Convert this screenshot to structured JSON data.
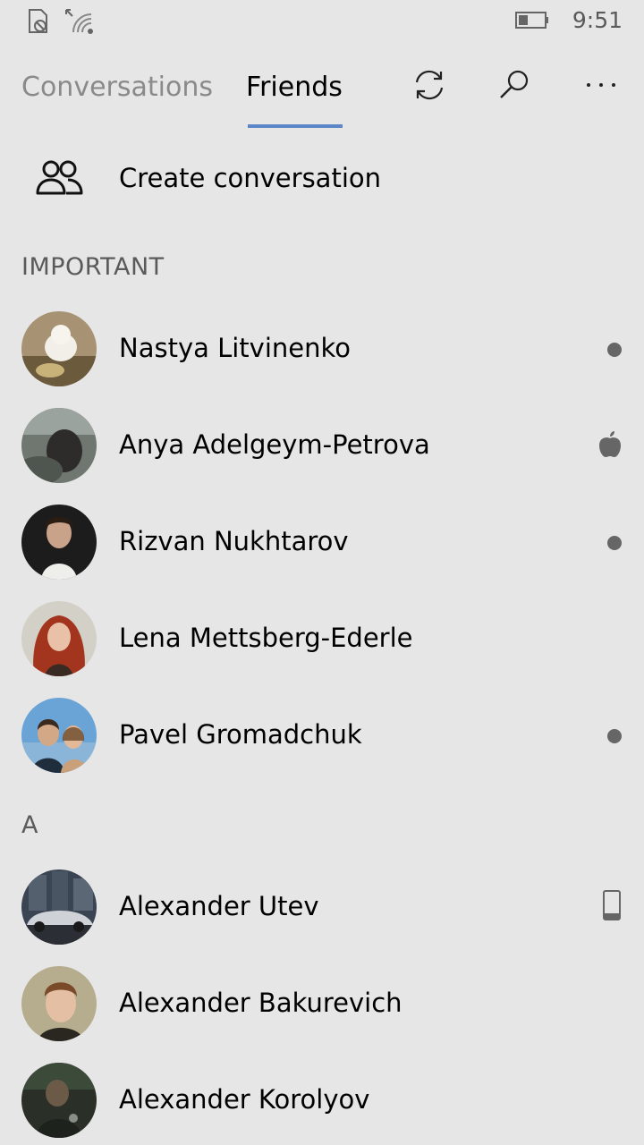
{
  "status_bar": {
    "time": "9:51",
    "icons": [
      "sim-icon",
      "wifi-icon",
      "battery-icon"
    ]
  },
  "header": {
    "tabs": [
      {
        "label": "Conversations",
        "active": false
      },
      {
        "label": "Friends",
        "active": true
      }
    ],
    "actions": [
      "refresh-icon",
      "search-icon",
      "more-icon"
    ],
    "accent_color": "#5b86c8"
  },
  "create_conversation": {
    "label": "Create conversation",
    "icon": "people-icon"
  },
  "sections": [
    {
      "title": "IMPORTANT",
      "friends": [
        {
          "name": "Nastya Litvinenko",
          "status": "online"
        },
        {
          "name": "Anya Adelgeym-Petrova",
          "status": "apple"
        },
        {
          "name": "Rizvan Nukhtarov",
          "status": "online"
        },
        {
          "name": "Lena Mettsberg-Ederle",
          "status": "none"
        },
        {
          "name": "Pavel Gromadchuk",
          "status": "online"
        }
      ]
    },
    {
      "title": "A",
      "friends": [
        {
          "name": "Alexander Utev",
          "status": "mobile"
        },
        {
          "name": "Alexander Bakurevich",
          "status": "none"
        },
        {
          "name": "Alexander Korolyov",
          "status": "none"
        }
      ]
    }
  ]
}
